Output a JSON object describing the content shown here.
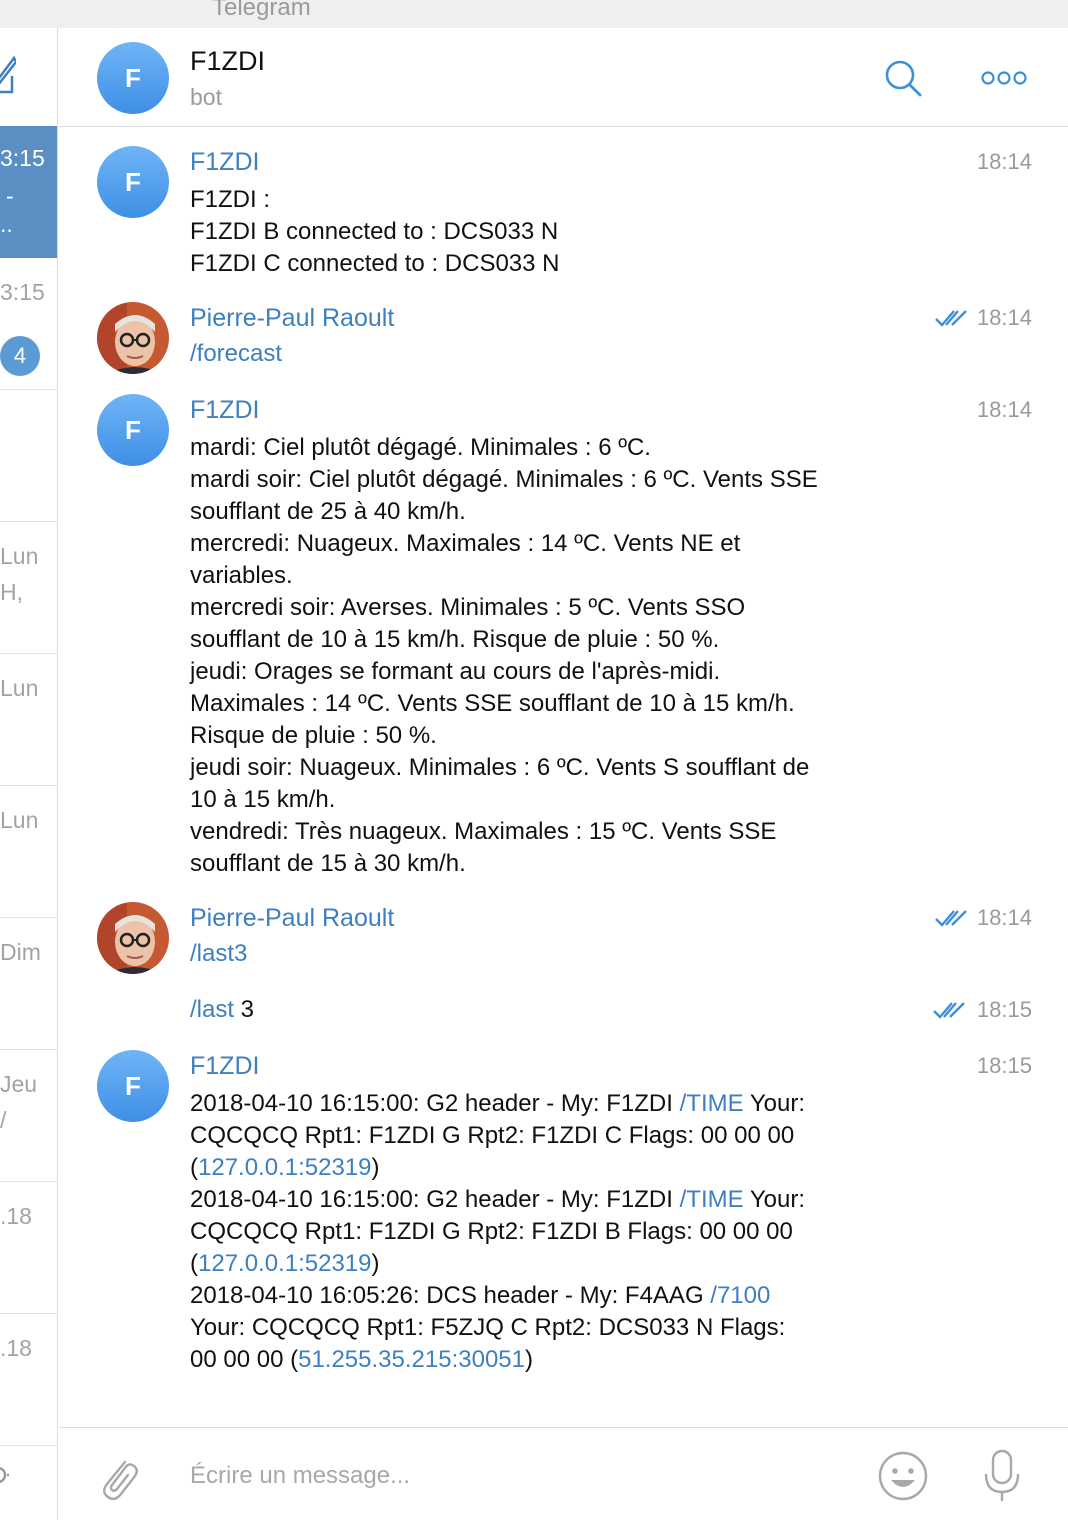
{
  "window": {
    "title": "Telegram"
  },
  "sidebar": {
    "rows": [
      {
        "time": "3:15",
        "line2": "-",
        "line3": "..",
        "active": true
      },
      {
        "time": "3:15",
        "badge": "4"
      },
      {
        "time": ""
      },
      {
        "time": "Lun",
        "line2": "H,"
      },
      {
        "time": "Lun"
      },
      {
        "time": "Lun"
      },
      {
        "time": "Dim"
      },
      {
        "time": "Jeu",
        "line2": "/"
      },
      {
        "time": ".18"
      },
      {
        "time": ".18"
      }
    ]
  },
  "header": {
    "title": "F1ZDI",
    "subtitle": "bot",
    "avatar_letter": "F"
  },
  "messages": [
    {
      "sender": "F1ZDI",
      "avatar_letter": "F",
      "time": "18:14",
      "lines": [
        "F1ZDI   :",
        "F1ZDI B connected to : DCS033 N",
        "F1ZDI C connected to : DCS033 N"
      ]
    },
    {
      "sender": "Pierre-Paul Raoult",
      "time": "18:14",
      "read": true,
      "command": "/forecast"
    },
    {
      "sender": "F1ZDI",
      "avatar_letter": "F",
      "time": "18:14",
      "lines": [
        "mardi: Ciel plutôt dégagé. Minimales : 6 ºC.",
        "mardi soir: Ciel plutôt dégagé. Minimales : 6 ºC. Vents SSE",
        "soufflant de 25 à 40 km/h.",
        "mercredi: Nuageux. Maximales : 14 ºC. Vents NE et",
        "variables.",
        "mercredi soir: Averses. Minimales : 5 ºC. Vents SSO",
        "soufflant de 10 à 15 km/h. Risque de pluie : 50 %.",
        "jeudi: Orages se formant au cours de l'après-midi.",
        "Maximales : 14 ºC. Vents SSE soufflant de 10 à 15 km/h.",
        "Risque de pluie : 50 %.",
        "jeudi soir: Nuageux. Minimales : 6 ºC. Vents S soufflant de",
        "10 à 15 km/h.",
        "vendredi: Très nuageux. Maximales : 15 ºC. Vents SSE",
        "soufflant de 15 à 30 km/h."
      ]
    },
    {
      "sender": "Pierre-Paul Raoult",
      "time": "18:14",
      "read": true,
      "command": "/last3"
    },
    {
      "time": "18:15",
      "read": true,
      "command": "/last",
      "command_arg": " 3"
    },
    {
      "sender": "F1ZDI",
      "avatar_letter": "F",
      "time": "18:15",
      "log": {
        "l1_pre": "2018-04-10 16:15:00: G2 header - My: F1ZDI   ",
        "l1_link": "/TIME",
        "l1_post": "  Your:",
        "l2": "CQCQCQ    Rpt1: F1ZDI  G  Rpt2: F1ZDI  C  Flags: 00 00 00",
        "l3_link": "127.0.0.1:52319",
        "l4_pre": "2018-04-10 16:15:00: G2 header - My: F1ZDI   ",
        "l4_link": "/TIME",
        "l4_post": "  Your:",
        "l5": "CQCQCQ    Rpt1: F1ZDI  G  Rpt2: F1ZDI  B  Flags: 00 00 00",
        "l6_link": "127.0.0.1:52319",
        "l7_pre": "2018-04-10 16:05:26: DCS header - My: F4AAG   ",
        "l7_link": "/7100",
        "l8": "Your: CQCQCQ     Rpt1: F5ZJQ  C  Rpt2: DCS033 N  Flags:",
        "l9_pre": "00 00 00 (",
        "l9_link": "51.255.35.215:30051",
        "l9_post": ")"
      }
    }
  ],
  "composer": {
    "placeholder": "Écrire un message..."
  },
  "colors": {
    "accent": "#3d7fc1",
    "active_chat": "#5b8fc4",
    "badge": "#5b9bd5",
    "muted": "#9a9a9a"
  },
  "icons": [
    "compose-icon",
    "search-icon",
    "more-icon",
    "double-check-icon",
    "attach-icon",
    "emoji-icon",
    "microphone-icon",
    "settings-icon"
  ]
}
